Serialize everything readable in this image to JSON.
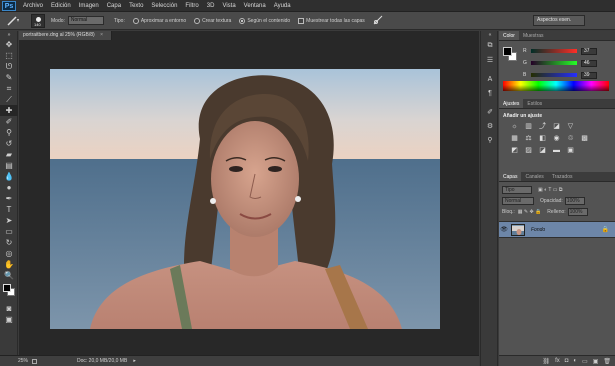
{
  "menu": [
    "Archivo",
    "Edición",
    "Imagen",
    "Capa",
    "Texto",
    "Selección",
    "Filtro",
    "3D",
    "Vista",
    "Ventana",
    "Ayuda"
  ],
  "options": {
    "brush_size": "140",
    "mode_label": "Modo:",
    "mode_value": "Normal",
    "type_label": "Tipo:",
    "radio_1": "Aproximar a entorno",
    "radio_2": "Crear textura",
    "radio_3": "Según el contenido",
    "checkbox": "Muestrear todas las capas",
    "workspace": "Aspectos esen."
  },
  "document": {
    "tab_title": "portraitbere.dng al 25% (RGB/8)",
    "zoom": "25%",
    "doc_info": "Doc: 20,0 MB/20,0 MB"
  },
  "color_panel": {
    "tabs": [
      "Color",
      "Muestras"
    ],
    "sliders": [
      {
        "label": "R",
        "value": "37"
      },
      {
        "label": "G",
        "value": "46"
      },
      {
        "label": "B",
        "value": "39"
      }
    ]
  },
  "adjust_panel": {
    "tabs": [
      "Ajustes",
      "Estilos"
    ],
    "title": "Añadir un ajuste"
  },
  "layers_panel": {
    "tabs": [
      "Capas",
      "Canales",
      "Trazados"
    ],
    "kind": "Tipo",
    "blend": "Normal",
    "opacity_label": "Opacidad:",
    "opacity_value": "100%",
    "lock_label": "Bloq.:",
    "fill_label": "Relleno:",
    "fill_value": "100%",
    "layer_name": "Fondo"
  }
}
